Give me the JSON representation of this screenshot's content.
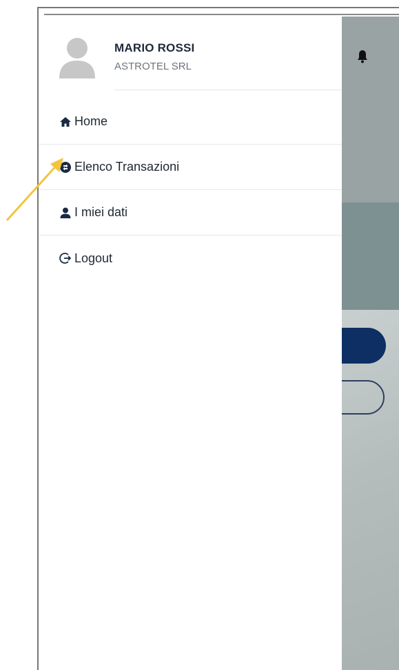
{
  "user": {
    "name": "MARIO ROSSI",
    "company": "ASTROTEL SRL"
  },
  "menu": {
    "items": [
      {
        "label": "Home",
        "icon": "home-icon"
      },
      {
        "label": "Elenco Transazioni",
        "icon": "transactions-icon"
      },
      {
        "label": "I miei dati",
        "icon": "user-icon"
      },
      {
        "label": "Logout",
        "icon": "logout-icon"
      }
    ]
  },
  "colors": {
    "primary": "#0e2f63",
    "annotation_arrow": "#f2c53d",
    "text": "#1e2732"
  }
}
